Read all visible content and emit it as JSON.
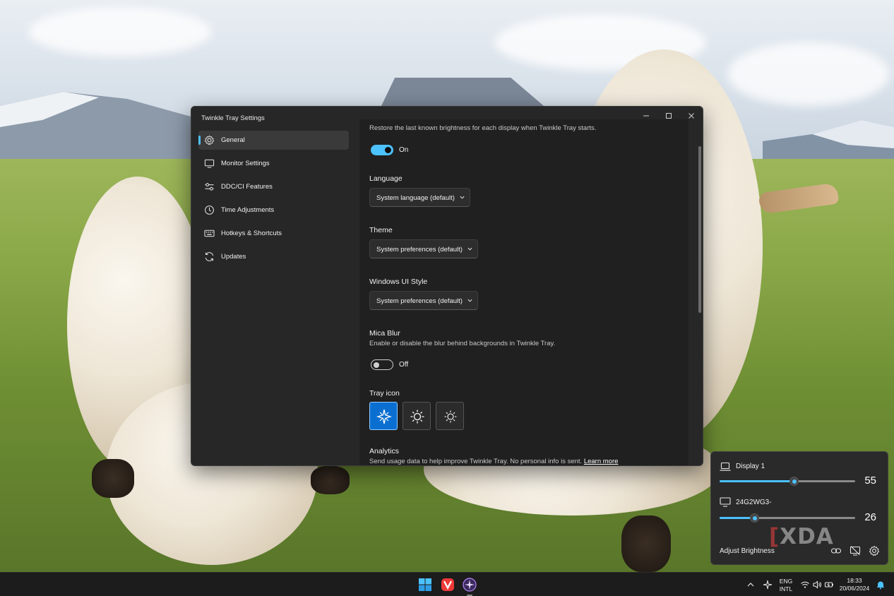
{
  "window": {
    "title": "Twinkle Tray Settings",
    "controls": {
      "minimize": "minimize-icon",
      "maximize": "maximize-icon",
      "close": "close-icon"
    }
  },
  "sidebar": {
    "items": [
      {
        "label": "General",
        "icon": "gear-icon",
        "active": true
      },
      {
        "label": "Monitor Settings",
        "icon": "monitor-icon",
        "active": false
      },
      {
        "label": "DDC/CI Features",
        "icon": "sliders-icon",
        "active": false
      },
      {
        "label": "Time Adjustments",
        "icon": "clock-icon",
        "active": false
      },
      {
        "label": "Hotkeys & Shortcuts",
        "icon": "keyboard-icon",
        "active": false
      },
      {
        "label": "Updates",
        "icon": "refresh-icon",
        "active": false
      }
    ]
  },
  "general": {
    "restore_brightness": {
      "description": "Restore the last known brightness for each display when Twinkle Tray starts.",
      "toggle_on": true,
      "toggle_label": "On"
    },
    "language": {
      "title": "Language",
      "value": "System language (default)"
    },
    "theme": {
      "title": "Theme",
      "value": "System preferences (default)"
    },
    "windows_ui_style": {
      "title": "Windows UI Style",
      "value": "System preferences (default)"
    },
    "mica_blur": {
      "title": "Mica Blur",
      "description": "Enable or disable the blur behind backgrounds in Twinkle Tray.",
      "toggle_on": false,
      "toggle_label": "Off"
    },
    "tray_icon": {
      "title": "Tray icon",
      "options": [
        "sparkle-icon",
        "sun-icon",
        "sun-outline-icon"
      ],
      "selected_index": 0
    },
    "analytics": {
      "title": "Analytics",
      "description": "Send usage data to help improve Twinkle Tray. No personal info is sent.",
      "link": "Learn more"
    }
  },
  "flyout": {
    "displays": [
      {
        "name": "Display 1",
        "icon": "laptop-icon",
        "brightness": 55
      },
      {
        "name": "24G2WG3-",
        "icon": "monitor-icon",
        "brightness": 26
      }
    ],
    "footer_label": "Adjust Brightness",
    "buttons": [
      "link-icon",
      "monitor-off-icon",
      "gear-icon"
    ],
    "watermark": "XDA"
  },
  "taskbar": {
    "apps": [
      "windows-start-icon",
      "vivaldi-icon",
      "twinkle-tray-icon"
    ],
    "language_line1": "ENG",
    "language_line2": "INTL",
    "time": "18:33",
    "date": "20/06/2024"
  },
  "colors": {
    "accent": "#4cc2ff",
    "selected_tile": "#0a6fd1",
    "window_bg": "#272727",
    "content_bg": "#202020",
    "taskbar_bg": "#1c1c1c"
  }
}
